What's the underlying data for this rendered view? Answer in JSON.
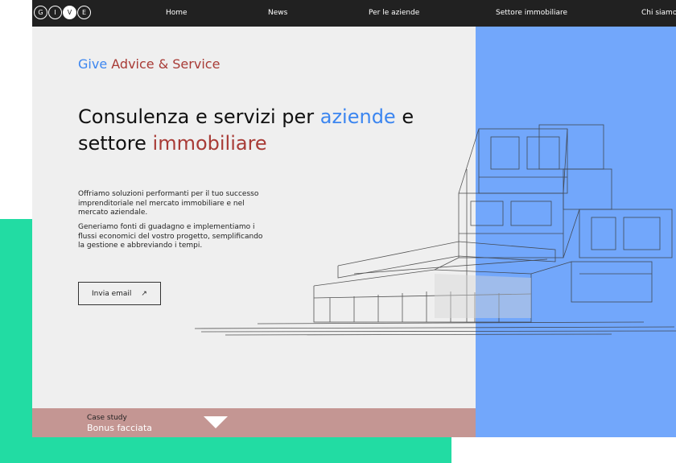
{
  "logo": {
    "letters": [
      "G",
      "I",
      "V",
      "E"
    ]
  },
  "nav": {
    "home": "Home",
    "news": "News",
    "aziende": "Per le aziende",
    "immobiliare": "Settore immobiliare",
    "chi_siamo": "Chi siamo"
  },
  "brand": {
    "part1": "Give",
    "part2": "Advice & Service"
  },
  "headline": {
    "line1_prefix": "Consulenza e servizi per",
    "line1_highlight": "aziende",
    "line1_suffix": "e",
    "line2_prefix": "settore",
    "line2_highlight": "immobiliare"
  },
  "intro": {
    "paragraph1": "Offriamo soluzioni performanti per il tuo successo imprenditoriale nel mercato immobiliare e nel mercato aziendale.",
    "paragraph2": "Generiamo fonti di guadagno e implementiamo i flussi economici del vostro progetto, semplificando la gestione e abbreviando i tempi."
  },
  "cta": {
    "label": "Invia email",
    "icon": "↗"
  },
  "case_study": {
    "label": "Case study",
    "title": "Bonus facciata"
  },
  "colors": {
    "accent_blue": "#3c86f0",
    "accent_red": "#a83b36",
    "panel_blue": "#72a7fb",
    "green": "#22dca3",
    "topbar": "#212121",
    "case_bar": "#c49693"
  }
}
